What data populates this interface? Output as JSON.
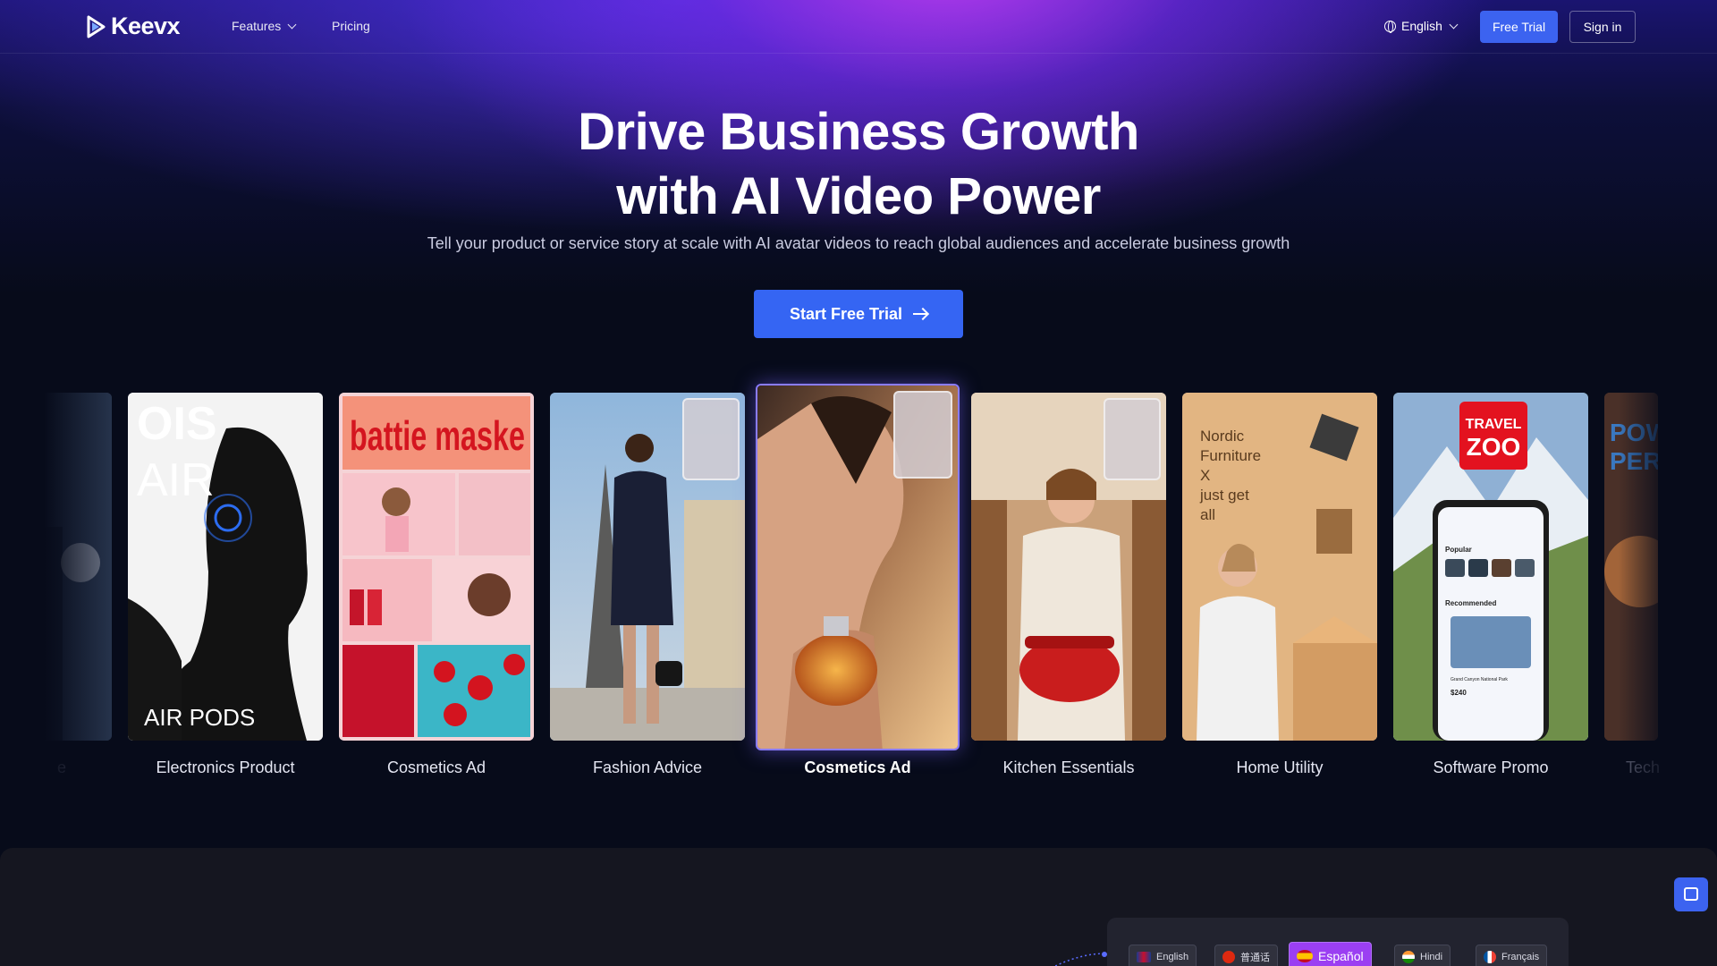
{
  "nav": {
    "brand": "Keevx",
    "features_label": "Features",
    "pricing_label": "Pricing",
    "language_label": "English",
    "free_trial_label": "Free Trial",
    "sign_in_label": "Sign in"
  },
  "hero": {
    "headline_line1": "Drive Business Growth",
    "headline_line2": "with AI Video Power",
    "subheadline": "Tell your product or service story at scale with AI avatar videos to reach global audiences and accelerate business growth",
    "cta_label": "Start Free Trial"
  },
  "showcase": {
    "left_partial_label": "e",
    "right_partial_label": "Tech",
    "cards": [
      {
        "label": "Electronics Product",
        "overlay_top": "OIS AIR",
        "overlay_bottom": "AIR PODS"
      },
      {
        "label": "Cosmetics Ad",
        "overlay_top": "battie maske"
      },
      {
        "label": "Fashion Advice"
      },
      {
        "label": "Cosmetics Ad",
        "active": true
      },
      {
        "label": "Kitchen Essentials"
      },
      {
        "label": "Home Utility",
        "overlay_top": "Nordic Furniture X just get all"
      },
      {
        "label": "Software Promo",
        "overlay_top": "TRAVEL ZOO",
        "app_popular": "Popular",
        "app_recommended": "Recommended",
        "app_place": "Grand Canyon National Park",
        "app_price": "$240"
      }
    ],
    "right_partial_text": "POW PER"
  },
  "languages": [
    {
      "label": "English",
      "flag": "uk"
    },
    {
      "label": "普通话",
      "flag": "cn"
    },
    {
      "label": "Español",
      "flag": "es",
      "active": true
    },
    {
      "label": "Hindi",
      "flag": "in"
    },
    {
      "label": "Français",
      "flag": "fr"
    }
  ],
  "colors": {
    "accent_blue": "#3c63f0",
    "accent_purple": "#9b3ff2",
    "background": "#070b1a"
  }
}
